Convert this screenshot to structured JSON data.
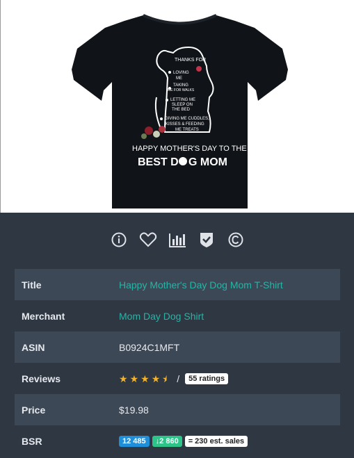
{
  "product_image": {
    "shirt_text": {
      "thanks_for": "THANKS FOR",
      "loving": "LOVING",
      "me1": "ME",
      "taking": "TAKING",
      "for_walks": "ME FOR WALKS",
      "letting": "LETTING ME",
      "sleep_on": "SLEEP ON",
      "the_bed": "THE BED",
      "giving": "GIVING ME CUDDLES,",
      "kisses": "KISSES & FEEDING",
      "treats": "ME TREATS",
      "happy": "HAPPY MOTHER'S DAY TO THE",
      "best": "BEST D",
      "mom": "G MOM"
    }
  },
  "icons": [
    "info-icon",
    "heart-icon",
    "chart-icon",
    "shield-check-icon",
    "copyright-icon"
  ],
  "rows": {
    "title": {
      "label": "Title",
      "value": "Happy Mother's Day Dog Mom T-Shirt"
    },
    "merchant": {
      "label": "Merchant",
      "value": "Mom Day Dog Shirt"
    },
    "asin": {
      "label": "ASIN",
      "value": "B0924C1MFT"
    },
    "reviews": {
      "label": "Reviews",
      "rating": 4.5,
      "slash": "/",
      "ratings_text": "55 ratings"
    },
    "price": {
      "label": "Price",
      "value": "$19.98"
    },
    "bsr": {
      "label": "BSR",
      "rank": "12 485",
      "change": "2 860",
      "change_arrow": "↓",
      "sales": "= 230 est. sales"
    }
  },
  "colors": {
    "link": "#27b4a6",
    "star": "#f3b229",
    "panel_bg": "#2f3742",
    "row_bg": "#3d4857",
    "bsr_rank": "#1e8fd8",
    "bsr_change": "#2dc48a"
  }
}
